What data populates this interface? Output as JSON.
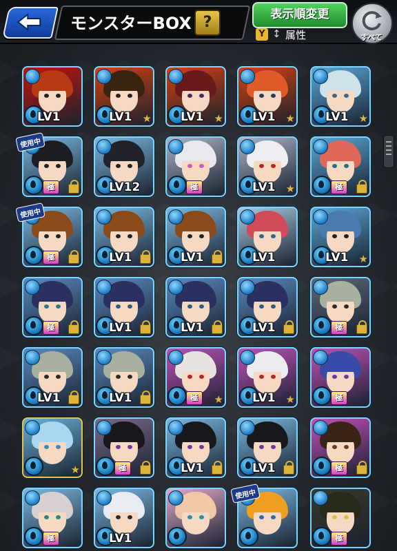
{
  "header": {
    "title": "モンスターBOX",
    "help_label": "?",
    "sort_label": "表示順変更",
    "filter_icon_label": "Y",
    "sort_order_icon": "↕",
    "attribute_label": "属性",
    "reset_label": "すべて"
  },
  "colors": {
    "accent_blue": "#2a67d8",
    "sort_green": "#3cb84a",
    "gold": "#e6c34a"
  },
  "monsters": [
    {
      "lv": "LV1",
      "star": false,
      "lock": false,
      "goku": false,
      "in_use": false,
      "hair": "#b83a12",
      "bg": "#c2140a",
      "eye": "#222"
    },
    {
      "lv": "LV1",
      "star": true,
      "lock": false,
      "goku": false,
      "in_use": false,
      "hair": "#3a2410",
      "bg": "#d2420c",
      "eye": "#222"
    },
    {
      "lv": "LV1",
      "star": true,
      "lock": false,
      "goku": false,
      "in_use": false,
      "hair": "#6a1a1a",
      "bg": "#d2420c",
      "eye": "#4a2a5a"
    },
    {
      "lv": "LV1",
      "star": true,
      "lock": false,
      "goku": false,
      "in_use": false,
      "hair": "#e05a2a",
      "bg": "#d2420c",
      "eye": "#2a3a5a"
    },
    {
      "lv": "LV1",
      "star": true,
      "lock": false,
      "goku": false,
      "in_use": false,
      "hair": "#cfe2ea",
      "bg": "#5aa8d8",
      "eye": "#3a6a8a"
    },
    {
      "lv": "",
      "star": false,
      "lock": true,
      "goku": true,
      "in_use": true,
      "hair": "#1c1c22",
      "bg": "#7ab8e0",
      "eye": "#222"
    },
    {
      "lv": "LV12",
      "star": false,
      "lock": false,
      "goku": false,
      "in_use": false,
      "hair": "#22222a",
      "bg": "#7ab8e0",
      "eye": "#222"
    },
    {
      "lv": "",
      "star": false,
      "lock": false,
      "goku": true,
      "in_use": false,
      "hair": "#e8e8ee",
      "bg": "#a8b4c8",
      "eye": "#c85ac0"
    },
    {
      "lv": "LV1",
      "star": true,
      "lock": false,
      "goku": false,
      "in_use": false,
      "hair": "#eeeef2",
      "bg": "#a8b4c8",
      "eye": "#b02a2a"
    },
    {
      "lv": "",
      "star": false,
      "lock": true,
      "goku": true,
      "in_use": false,
      "hair": "#e0685a",
      "bg": "#5aa8d8",
      "eye": "#2a6a8a"
    },
    {
      "lv": "",
      "star": false,
      "lock": true,
      "goku": true,
      "in_use": true,
      "hair": "#8a4a1a",
      "bg": "#7ab8e0",
      "eye": "#222"
    },
    {
      "lv": "LV1",
      "star": false,
      "lock": true,
      "goku": false,
      "in_use": false,
      "hair": "#8a4a1a",
      "bg": "#7ab8e0",
      "eye": "#222"
    },
    {
      "lv": "LV1",
      "star": false,
      "lock": true,
      "goku": false,
      "in_use": false,
      "hair": "#8a4a1a",
      "bg": "#7ab8e0",
      "eye": "#222"
    },
    {
      "lv": "LV1",
      "star": false,
      "lock": false,
      "goku": false,
      "in_use": false,
      "hair": "#d04a5a",
      "bg": "#a8c8e0",
      "eye": "#2a6a8a"
    },
    {
      "lv": "LV1",
      "star": true,
      "lock": false,
      "goku": false,
      "in_use": false,
      "hair": "#4a7ab0",
      "bg": "#5aa8d8",
      "eye": "#222"
    },
    {
      "lv": "",
      "star": false,
      "lock": true,
      "goku": true,
      "in_use": false,
      "hair": "#2a3060",
      "bg": "#5a8ac0",
      "eye": "#2a7a8a"
    },
    {
      "lv": "LV1",
      "star": false,
      "lock": true,
      "goku": false,
      "in_use": false,
      "hair": "#2a3060",
      "bg": "#5a8ac0",
      "eye": "#2a5a8a"
    },
    {
      "lv": "LV1",
      "star": false,
      "lock": true,
      "goku": false,
      "in_use": false,
      "hair": "#2a3060",
      "bg": "#5a8ac0",
      "eye": "#2a5a8a"
    },
    {
      "lv": "LV1",
      "star": false,
      "lock": true,
      "goku": false,
      "in_use": false,
      "hair": "#2a3060",
      "bg": "#5a8ac0",
      "eye": "#2a5a8a"
    },
    {
      "lv": "",
      "star": false,
      "lock": true,
      "goku": true,
      "in_use": false,
      "hair": "#a8b0a0",
      "bg": "#5a6a7a",
      "eye": "#2a2a2a"
    },
    {
      "lv": "LV1",
      "star": false,
      "lock": true,
      "goku": false,
      "in_use": false,
      "hair": "#a8b0a0",
      "bg": "#5a8ac0",
      "eye": "#2a2a2a"
    },
    {
      "lv": "LV1",
      "star": false,
      "lock": true,
      "goku": false,
      "in_use": false,
      "hair": "#a8b0a0",
      "bg": "#5a8ac0",
      "eye": "#2a2a2a"
    },
    {
      "lv": "",
      "star": true,
      "lock": false,
      "goku": true,
      "in_use": false,
      "hair": "#e8e2e0",
      "bg": "#c050b8",
      "eye": "#b02a2a"
    },
    {
      "lv": "LV1",
      "star": true,
      "lock": false,
      "goku": false,
      "in_use": false,
      "hair": "#ececf0",
      "bg": "#c050b8",
      "eye": "#b02a2a"
    },
    {
      "lv": "",
      "star": false,
      "lock": false,
      "goku": true,
      "in_use": false,
      "hair": "#3a4aa8",
      "bg": "#c050b8",
      "eye": "#6a3a9a"
    },
    {
      "lv": "",
      "star": true,
      "lock": false,
      "goku": false,
      "in_use": false,
      "hair": "#a8d8f0",
      "bg": "#6ab0d8",
      "eye": "#3a8ab0"
    },
    {
      "lv": "",
      "star": false,
      "lock": true,
      "goku": true,
      "in_use": false,
      "hair": "#18181c",
      "bg": "#7a6a8a",
      "eye": "#6a3a9a"
    },
    {
      "lv": "LV1",
      "star": false,
      "lock": true,
      "goku": false,
      "in_use": false,
      "hair": "#18181c",
      "bg": "#7ab8e0",
      "eye": "#6a3a9a"
    },
    {
      "lv": "LV1",
      "star": false,
      "lock": true,
      "goku": false,
      "in_use": false,
      "hair": "#18181c",
      "bg": "#7ab8e0",
      "eye": "#6a3a9a"
    },
    {
      "lv": "",
      "star": false,
      "lock": true,
      "goku": true,
      "in_use": false,
      "hair": "#3a2418",
      "bg": "#c050b8",
      "eye": "#6a3a2a"
    },
    {
      "lv": "",
      "star": false,
      "lock": false,
      "goku": true,
      "in_use": false,
      "hair": "#d8d0d0",
      "bg": "#7ab8e0",
      "eye": "#2a8a7a"
    },
    {
      "lv": "LV1",
      "star": false,
      "lock": false,
      "goku": false,
      "in_use": false,
      "hair": "#e8ecf2",
      "bg": "#7ab8e0",
      "eye": "#2a2a2a"
    },
    {
      "lv": "",
      "star": false,
      "lock": false,
      "goku": false,
      "in_use": false,
      "hair": "#f0c8a8",
      "bg": "#e0a8c8",
      "eye": "#2a8ab0"
    },
    {
      "lv": "",
      "star": false,
      "lock": false,
      "goku": false,
      "in_use": true,
      "hair": "#f0a020",
      "bg": "#7ab8e0",
      "eye": "#2a6ab0"
    },
    {
      "lv": "",
      "star": false,
      "lock": false,
      "goku": true,
      "in_use": false,
      "hair": "#2a2a1a",
      "bg": "#3a3a2a",
      "eye": "#d8c040"
    }
  ],
  "in_use_label": "使用中",
  "goku_label": "極",
  "star_glyph": "★"
}
